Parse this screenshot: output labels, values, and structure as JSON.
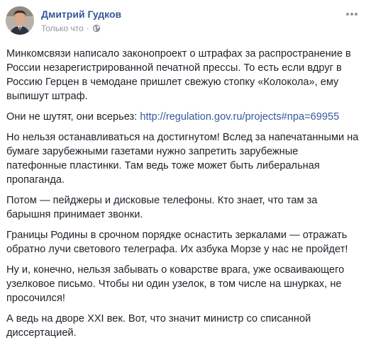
{
  "post": {
    "author": "Дмитрий Гудков",
    "time": "Только что",
    "dot": "·",
    "paragraphs": [
      "Минкомсвязи написало законопроект о штрафах за распространение в России незарегистрированной печатной прессы. То есть если вдруг в Россию Герцен в чемодане пришлет свежую стопку «Колокола», ему выпишут штраф.",
      "Но нельзя останавливаться на достигнутом! Вслед за напечатанными на бумаге зарубежными газетами нужно запретить зарубежные патефонные пластинки. Там ведь тоже может быть либеральная пропаганда.",
      "Потом — пейджеры и дисковые телефоны. Кто знает, что там за барышня принимает звонки.",
      "Границы Родины в срочном порядке оснастить зеркалами — отражать обратно лучи светового телеграфа. Их азбука Морзе у нас не пройдет!",
      "Ну и, конечно, нельзя забывать о коварстве врага, уже осваивающего узелковое письмо. Чтобы ни один узелок, в том числе на шнурках, не просочился!",
      "А ведь на дворе XXI век. Вот, что значит министр со списанной диссертацией."
    ],
    "link_paragraph": {
      "prefix": "Они не шутят, они всерьез: ",
      "url": "http://regulation.gov.ru/projects#npa=69955"
    }
  },
  "icons": {
    "privacy": "globe-icon",
    "menu": "more-options-icon"
  },
  "colors": {
    "author": "#365899",
    "link": "#365899",
    "meta": "#90949c",
    "text": "#1d2129"
  }
}
